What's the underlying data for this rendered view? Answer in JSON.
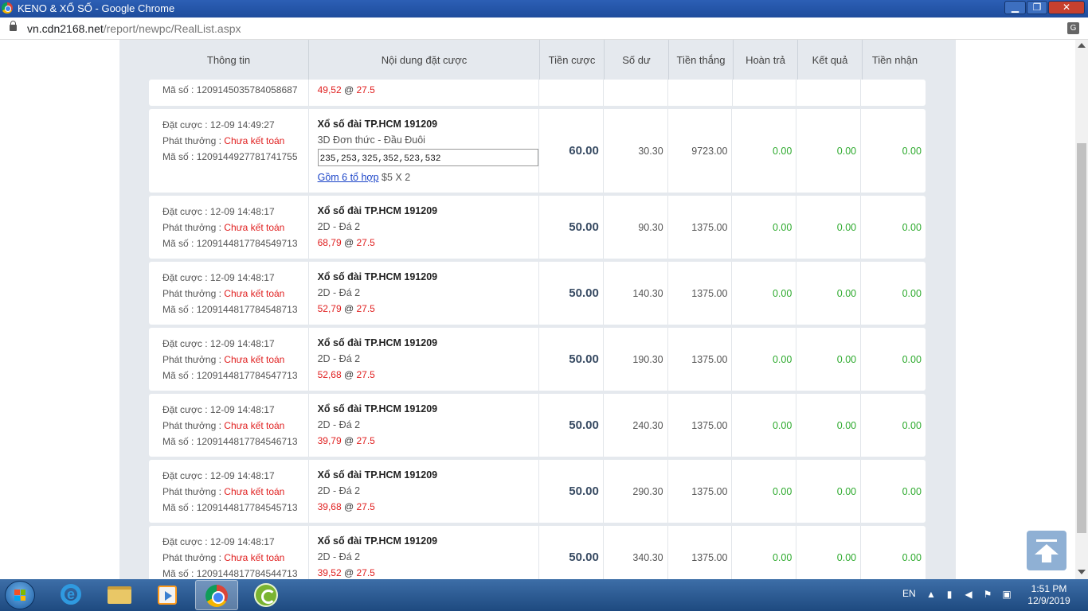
{
  "window": {
    "title": "KENO & XỔ SỐ - Google Chrome",
    "minimize": "▁",
    "maximize": "❐",
    "close": "✕"
  },
  "address": {
    "host": "vn.cdn2168.net",
    "path": "/report/newpc/RealList.aspx"
  },
  "table": {
    "headers": [
      "Thông tin",
      "Nội dung đặt cược",
      "Tiền cược",
      "Số dư",
      "Tiền thắng",
      "Hoàn trả",
      "Kết quả",
      "Tiền nhận"
    ],
    "labels": {
      "placed": "Đặt cược : ",
      "payout": "Phát thưởng : ",
      "id": "Mã số : ",
      "status": "Chưa kết toán",
      "at": " @ "
    },
    "partial_row": {
      "id": "1209145035784058687",
      "pick": "49,52",
      "odds": "27.5"
    },
    "combo_row": {
      "time": "12-09 14:49:27",
      "id": "1209144927781741755",
      "lottery": "Xổ số đài TP.HCM 191209",
      "type": "3D Đơn thức - Đầu Đuôi",
      "numbers": "235,253,325,352,523,532",
      "combo_link": "Gồm 6 tổ hợp",
      "combo_rest": " $5 X 2",
      "stake": "60.00",
      "balance": "30.30",
      "win": "9723.00",
      "refund": "0.00",
      "result": "0.00",
      "receive": "0.00"
    },
    "rows": [
      {
        "time": "12-09 14:48:17",
        "id": "1209144817784549713",
        "lottery": "Xổ số đài TP.HCM 191209",
        "type": "2D - Đá 2",
        "pick": "68,79",
        "odds": "27.5",
        "stake": "50.00",
        "balance": "90.30",
        "win": "1375.00",
        "refund": "0.00",
        "result": "0.00",
        "receive": "0.00"
      },
      {
        "time": "12-09 14:48:17",
        "id": "1209144817784548713",
        "lottery": "Xổ số đài TP.HCM 191209",
        "type": "2D - Đá 2",
        "pick": "52,79",
        "odds": "27.5",
        "stake": "50.00",
        "balance": "140.30",
        "win": "1375.00",
        "refund": "0.00",
        "result": "0.00",
        "receive": "0.00"
      },
      {
        "time": "12-09 14:48:17",
        "id": "1209144817784547713",
        "lottery": "Xổ số đài TP.HCM 191209",
        "type": "2D - Đá 2",
        "pick": "52,68",
        "odds": "27.5",
        "stake": "50.00",
        "balance": "190.30",
        "win": "1375.00",
        "refund": "0.00",
        "result": "0.00",
        "receive": "0.00"
      },
      {
        "time": "12-09 14:48:17",
        "id": "1209144817784546713",
        "lottery": "Xổ số đài TP.HCM 191209",
        "type": "2D - Đá 2",
        "pick": "39,79",
        "odds": "27.5",
        "stake": "50.00",
        "balance": "240.30",
        "win": "1375.00",
        "refund": "0.00",
        "result": "0.00",
        "receive": "0.00"
      },
      {
        "time": "12-09 14:48:17",
        "id": "1209144817784545713",
        "lottery": "Xổ số đài TP.HCM 191209",
        "type": "2D - Đá 2",
        "pick": "39,68",
        "odds": "27.5",
        "stake": "50.00",
        "balance": "290.30",
        "win": "1375.00",
        "refund": "0.00",
        "result": "0.00",
        "receive": "0.00"
      },
      {
        "time": "12-09 14:48:17",
        "id": "1209144817784544713",
        "lottery": "Xổ số đài TP.HCM 191209",
        "type": "2D - Đá 2",
        "pick": "39,52",
        "odds": "27.5",
        "stake": "50.00",
        "balance": "340.30",
        "win": "1375.00",
        "refund": "0.00",
        "result": "0.00",
        "receive": "0.00"
      }
    ]
  },
  "taskbar": {
    "lang": "EN",
    "time": "1:51 PM",
    "date": "12/9/2019",
    "icons": [
      "start-icon",
      "ie-icon",
      "folder-icon",
      "media-player-icon",
      "chrome-icon",
      "coccoc-icon"
    ]
  },
  "colors": {
    "status_red": "#e02020",
    "money_green": "#2eaa2e",
    "stake_blue": "#374a62",
    "panel_bg": "#e5e9ee"
  }
}
